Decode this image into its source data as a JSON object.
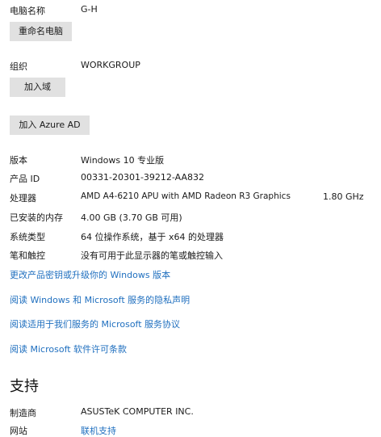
{
  "computer": {
    "name_label": "电脑名称",
    "name_value": "G-H",
    "rename_button": "重命名电脑",
    "org_label": "组织",
    "org_value": "WORKGROUP",
    "join_domain_button": "加入域",
    "join_azure_button": "加入 Azure AD"
  },
  "specs": {
    "edition_label": "版本",
    "edition_value": "Windows 10 专业版",
    "product_id_label": "产品 ID",
    "product_id_value": "00331-20301-39212-AA832",
    "processor_label": "处理器",
    "processor_value": "AMD A4-6210 APU with AMD Radeon R3 Graphics",
    "processor_speed": "1.80 GHz",
    "ram_label": "已安装的内存",
    "ram_value": "4.00 GB (3.70 GB 可用)",
    "system_type_label": "系统类型",
    "system_type_value": "64 位操作系统，基于 x64 的处理器",
    "pen_touch_label": "笔和触控",
    "pen_touch_value": "没有可用于此显示器的笔或触控输入"
  },
  "links": {
    "change_product_key": "更改产品密钥或升级你的 Windows 版本",
    "privacy_statement": "阅读 Windows 和 Microsoft 服务的隐私声明",
    "services_agreement": "阅读适用于我们服务的 Microsoft 服务协议",
    "license_terms": "阅读 Microsoft 软件许可条款"
  },
  "support": {
    "title": "支持",
    "manufacturer_label": "制造商",
    "manufacturer_value": "ASUSTeK COMPUTER INC.",
    "website_label": "网站",
    "website_value": "联机支持"
  }
}
